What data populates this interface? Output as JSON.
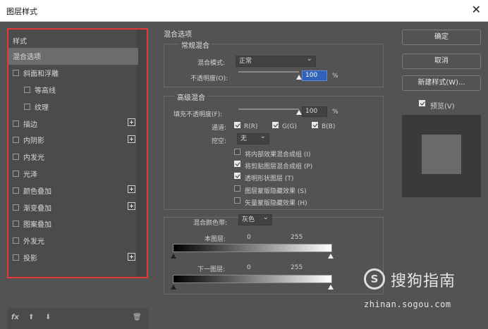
{
  "window": {
    "title": "图层样式",
    "close": "✕"
  },
  "left_panel": {
    "header": "样式",
    "items": [
      {
        "label": "混合选项",
        "checkbox": false,
        "plus": false,
        "selected": true,
        "indent": 0
      },
      {
        "label": "斜面和浮雕",
        "checkbox": true,
        "plus": false,
        "indent": 0
      },
      {
        "label": "等高线",
        "checkbox": true,
        "plus": false,
        "indent": 1
      },
      {
        "label": "纹理",
        "checkbox": true,
        "plus": false,
        "indent": 1
      },
      {
        "label": "描边",
        "checkbox": true,
        "plus": true,
        "indent": 0
      },
      {
        "label": "内阴影",
        "checkbox": true,
        "plus": true,
        "indent": 0
      },
      {
        "label": "内发光",
        "checkbox": true,
        "plus": false,
        "indent": 0
      },
      {
        "label": "光泽",
        "checkbox": true,
        "plus": false,
        "indent": 0
      },
      {
        "label": "颜色叠加",
        "checkbox": true,
        "plus": true,
        "indent": 0
      },
      {
        "label": "渐变叠加",
        "checkbox": true,
        "plus": true,
        "indent": 0
      },
      {
        "label": "图案叠加",
        "checkbox": true,
        "plus": false,
        "indent": 0
      },
      {
        "label": "外发光",
        "checkbox": true,
        "plus": false,
        "indent": 0
      },
      {
        "label": "投影",
        "checkbox": true,
        "plus": true,
        "indent": 0
      }
    ],
    "bottom": {
      "fx": "fx",
      "up": "⬆",
      "down": "⬇",
      "trash": "🗑"
    }
  },
  "blend_options": {
    "title": "混合选项",
    "general": {
      "title": "常规混合",
      "mode_label": "混合模式:",
      "mode_value": "正常",
      "opacity_label": "不透明度(O):",
      "opacity_value": "100",
      "opacity_unit": "%",
      "opacity_level": 1.0
    },
    "advanced": {
      "title": "高级混合",
      "fill_label": "填充不透明度(F):",
      "fill_value": "100",
      "fill_unit": "%",
      "fill_level": 1.0,
      "channels_label": "通道:",
      "channels": [
        {
          "label": "R(R)",
          "checked": true
        },
        {
          "label": "G(G)",
          "checked": true
        },
        {
          "label": "B(B)",
          "checked": true
        }
      ],
      "knockout_label": "挖空:",
      "knockout_value": "无",
      "options": [
        {
          "label": "将内部效果混合成组 (I)",
          "checked": false
        },
        {
          "label": "将剪贴图层混合成组 (P)",
          "checked": true
        },
        {
          "label": "透明形状图层 (T)",
          "checked": true
        },
        {
          "label": "图层蒙版隐藏效果 (S)",
          "checked": false
        },
        {
          "label": "矢量蒙版隐藏效果 (H)",
          "checked": false
        }
      ]
    },
    "blend_if": {
      "label": "混合颜色带:",
      "value": "灰色",
      "this_layer": {
        "label": "本图层:",
        "min": "0",
        "max": "255"
      },
      "underlying": {
        "label": "下一图层:",
        "min": "0",
        "max": "255"
      }
    }
  },
  "buttons": {
    "ok": "确定",
    "cancel": "取消",
    "new_style": "新建样式(W)...",
    "preview_label": "预览(V)",
    "preview_checked": true
  },
  "watermark": {
    "text": "搜狗指南",
    "url": "zhinan.sogou.com",
    "symbol": "S"
  }
}
